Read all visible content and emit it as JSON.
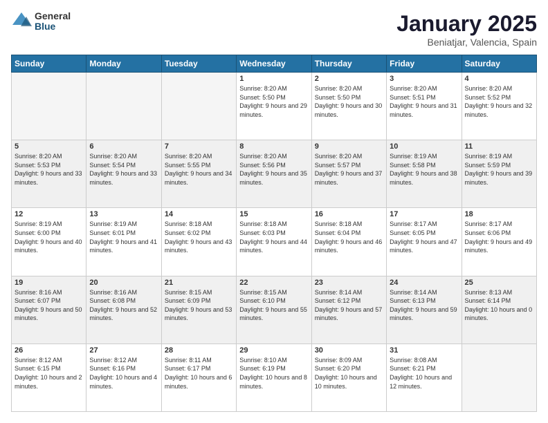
{
  "logo": {
    "general": "General",
    "blue": "Blue"
  },
  "header": {
    "month": "January 2025",
    "location": "Beniatjar, Valencia, Spain"
  },
  "weekdays": [
    "Sunday",
    "Monday",
    "Tuesday",
    "Wednesday",
    "Thursday",
    "Friday",
    "Saturday"
  ],
  "weeks": [
    [
      {
        "day": "",
        "info": ""
      },
      {
        "day": "",
        "info": ""
      },
      {
        "day": "",
        "info": ""
      },
      {
        "day": "1",
        "info": "Sunrise: 8:20 AM\nSunset: 5:50 PM\nDaylight: 9 hours and 29 minutes."
      },
      {
        "day": "2",
        "info": "Sunrise: 8:20 AM\nSunset: 5:50 PM\nDaylight: 9 hours and 30 minutes."
      },
      {
        "day": "3",
        "info": "Sunrise: 8:20 AM\nSunset: 5:51 PM\nDaylight: 9 hours and 31 minutes."
      },
      {
        "day": "4",
        "info": "Sunrise: 8:20 AM\nSunset: 5:52 PM\nDaylight: 9 hours and 32 minutes."
      }
    ],
    [
      {
        "day": "5",
        "info": "Sunrise: 8:20 AM\nSunset: 5:53 PM\nDaylight: 9 hours and 33 minutes."
      },
      {
        "day": "6",
        "info": "Sunrise: 8:20 AM\nSunset: 5:54 PM\nDaylight: 9 hours and 33 minutes."
      },
      {
        "day": "7",
        "info": "Sunrise: 8:20 AM\nSunset: 5:55 PM\nDaylight: 9 hours and 34 minutes."
      },
      {
        "day": "8",
        "info": "Sunrise: 8:20 AM\nSunset: 5:56 PM\nDaylight: 9 hours and 35 minutes."
      },
      {
        "day": "9",
        "info": "Sunrise: 8:20 AM\nSunset: 5:57 PM\nDaylight: 9 hours and 37 minutes."
      },
      {
        "day": "10",
        "info": "Sunrise: 8:19 AM\nSunset: 5:58 PM\nDaylight: 9 hours and 38 minutes."
      },
      {
        "day": "11",
        "info": "Sunrise: 8:19 AM\nSunset: 5:59 PM\nDaylight: 9 hours and 39 minutes."
      }
    ],
    [
      {
        "day": "12",
        "info": "Sunrise: 8:19 AM\nSunset: 6:00 PM\nDaylight: 9 hours and 40 minutes."
      },
      {
        "day": "13",
        "info": "Sunrise: 8:19 AM\nSunset: 6:01 PM\nDaylight: 9 hours and 41 minutes."
      },
      {
        "day": "14",
        "info": "Sunrise: 8:18 AM\nSunset: 6:02 PM\nDaylight: 9 hours and 43 minutes."
      },
      {
        "day": "15",
        "info": "Sunrise: 8:18 AM\nSunset: 6:03 PM\nDaylight: 9 hours and 44 minutes."
      },
      {
        "day": "16",
        "info": "Sunrise: 8:18 AM\nSunset: 6:04 PM\nDaylight: 9 hours and 46 minutes."
      },
      {
        "day": "17",
        "info": "Sunrise: 8:17 AM\nSunset: 6:05 PM\nDaylight: 9 hours and 47 minutes."
      },
      {
        "day": "18",
        "info": "Sunrise: 8:17 AM\nSunset: 6:06 PM\nDaylight: 9 hours and 49 minutes."
      }
    ],
    [
      {
        "day": "19",
        "info": "Sunrise: 8:16 AM\nSunset: 6:07 PM\nDaylight: 9 hours and 50 minutes."
      },
      {
        "day": "20",
        "info": "Sunrise: 8:16 AM\nSunset: 6:08 PM\nDaylight: 9 hours and 52 minutes."
      },
      {
        "day": "21",
        "info": "Sunrise: 8:15 AM\nSunset: 6:09 PM\nDaylight: 9 hours and 53 minutes."
      },
      {
        "day": "22",
        "info": "Sunrise: 8:15 AM\nSunset: 6:10 PM\nDaylight: 9 hours and 55 minutes."
      },
      {
        "day": "23",
        "info": "Sunrise: 8:14 AM\nSunset: 6:12 PM\nDaylight: 9 hours and 57 minutes."
      },
      {
        "day": "24",
        "info": "Sunrise: 8:14 AM\nSunset: 6:13 PM\nDaylight: 9 hours and 59 minutes."
      },
      {
        "day": "25",
        "info": "Sunrise: 8:13 AM\nSunset: 6:14 PM\nDaylight: 10 hours and 0 minutes."
      }
    ],
    [
      {
        "day": "26",
        "info": "Sunrise: 8:12 AM\nSunset: 6:15 PM\nDaylight: 10 hours and 2 minutes."
      },
      {
        "day": "27",
        "info": "Sunrise: 8:12 AM\nSunset: 6:16 PM\nDaylight: 10 hours and 4 minutes."
      },
      {
        "day": "28",
        "info": "Sunrise: 8:11 AM\nSunset: 6:17 PM\nDaylight: 10 hours and 6 minutes."
      },
      {
        "day": "29",
        "info": "Sunrise: 8:10 AM\nSunset: 6:19 PM\nDaylight: 10 hours and 8 minutes."
      },
      {
        "day": "30",
        "info": "Sunrise: 8:09 AM\nSunset: 6:20 PM\nDaylight: 10 hours and 10 minutes."
      },
      {
        "day": "31",
        "info": "Sunrise: 8:08 AM\nSunset: 6:21 PM\nDaylight: 10 hours and 12 minutes."
      },
      {
        "day": "",
        "info": ""
      }
    ]
  ]
}
